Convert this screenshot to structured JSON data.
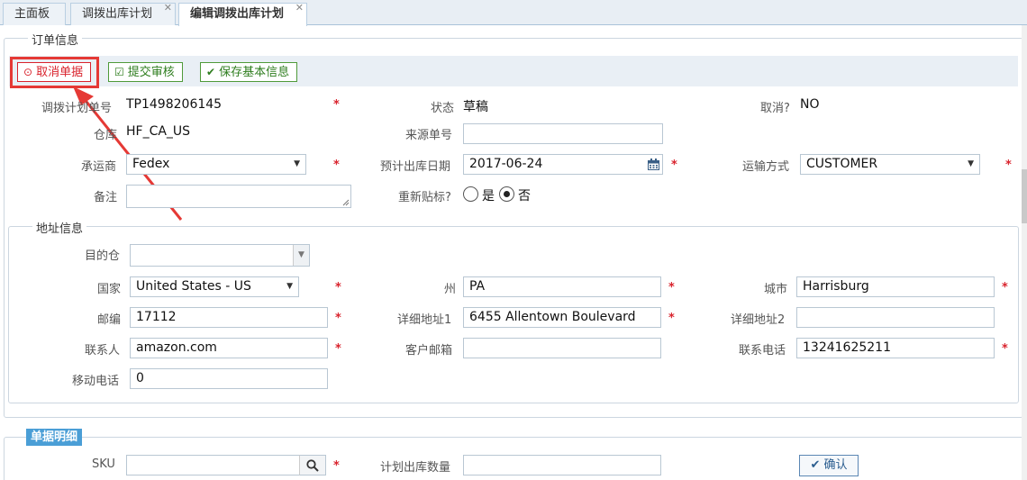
{
  "tabs": [
    {
      "label": "主面板"
    },
    {
      "label": "调拨出库计划"
    },
    {
      "label": "编辑调拨出库计划"
    }
  ],
  "order_section": {
    "legend": "订单信息",
    "toolbar": {
      "cancel_label": "取消单据",
      "submit_label": "提交审核",
      "save_label": "保存基本信息"
    },
    "plan_no_label": "调拨计划单号",
    "plan_no": "TP1498206145",
    "status_label": "状态",
    "status": "草稿",
    "cancelled_label": "取消?",
    "cancelled": "NO",
    "warehouse_label": "仓库",
    "warehouse": "HF_CA_US",
    "source_no_label": "来源单号",
    "source_no": "",
    "carrier_label": "承运商",
    "carrier": "Fedex",
    "ship_date_label": "预计出库日期",
    "ship_date": "2017-06-24",
    "shipping_method_label": "运输方式",
    "shipping_method": "CUSTOMER",
    "remark_label": "备注",
    "remark": "",
    "relabel_label": "重新贴标?",
    "relabel_yes": "是",
    "relabel_no": "否",
    "relabel_selected": "否"
  },
  "address_section": {
    "legend": "地址信息",
    "dest_warehouse_label": "目的仓",
    "dest_warehouse": "",
    "country_label": "国家",
    "country": "United States - US",
    "state_label": "州",
    "state": "PA",
    "city_label": "城市",
    "city": "Harrisburg",
    "zip_label": "邮编",
    "zip": "17112",
    "address1_label": "详细地址1",
    "address1": "6455 Allentown Boulevard",
    "address2_label": "详细地址2",
    "address2": "",
    "contact_label": "联系人",
    "contact": "amazon.com",
    "email_label": "客户邮箱",
    "email": "",
    "phone_label": "联系电话",
    "phone": "13241625211",
    "mobile_label": "移动电话",
    "mobile": "0"
  },
  "detail_section": {
    "tag": "单据明细",
    "sku_label": "SKU",
    "sku": "",
    "qty_label": "计划出库数量",
    "qty": "",
    "confirm_label": "确认"
  },
  "required_mark": "*",
  "colors": {
    "required": "#d9232d",
    "highlight": "#e53935",
    "tag_bg": "#4a9ed6"
  }
}
